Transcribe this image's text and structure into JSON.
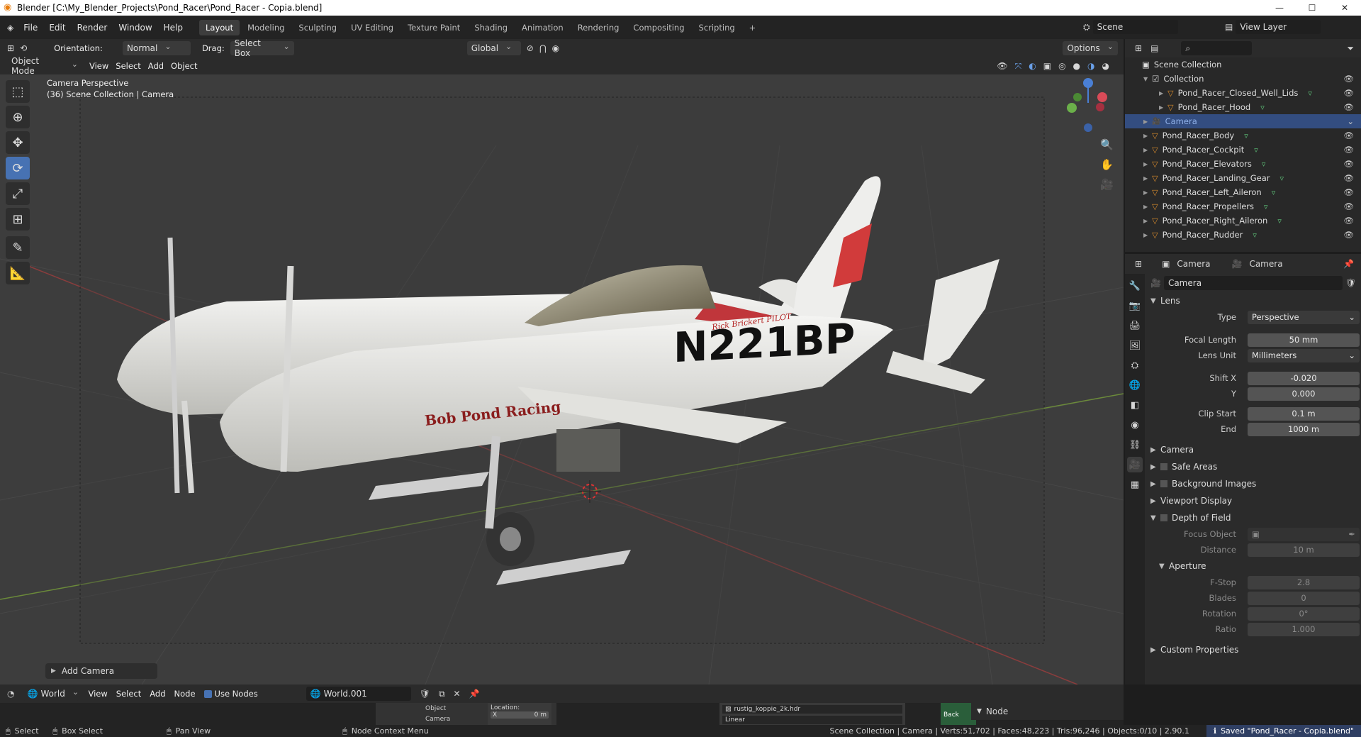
{
  "app": {
    "title": "Blender [C:\\My_Blender_Projects\\Pond_Racer\\Pond_Racer - Copia.blend]",
    "min": "—",
    "max": "☐",
    "close": "✕"
  },
  "menu": [
    "File",
    "Edit",
    "Render",
    "Window",
    "Help"
  ],
  "workspaces": [
    "Layout",
    "Modeling",
    "Sculpting",
    "UV Editing",
    "Texture Paint",
    "Shading",
    "Animation",
    "Rendering",
    "Compositing",
    "Scripting",
    "+"
  ],
  "active_workspace": "Layout",
  "scene": "Scene",
  "view_layer": "View Layer",
  "header": {
    "orientation_label": "Orientation:",
    "orientation": "Normal",
    "drag_label": "Drag:",
    "drag": "Select Box",
    "transform": "Global",
    "options": "Options"
  },
  "header2": {
    "mode": "Object Mode",
    "menus": [
      "View",
      "Select",
      "Add",
      "Object"
    ]
  },
  "viewport": {
    "line1": "Camera Perspective",
    "line2": "(36) Scene Collection | Camera",
    "operator_panel": "Add Camera",
    "registration": "N221BP",
    "livery": "Bob Pond Racing",
    "pilot": "Rick Brickert PILOT"
  },
  "outliner": {
    "root": "Scene Collection",
    "items": [
      {
        "name": "Collection",
        "level": 1
      },
      {
        "name": "Pond_Racer_Closed_Well_Lids",
        "level": 2
      },
      {
        "name": "Pond_Racer_Hood",
        "level": 2
      },
      {
        "name": "Camera",
        "level": 1,
        "selected": true
      },
      {
        "name": "Pond_Racer_Body",
        "level": 1
      },
      {
        "name": "Pond_Racer_Cockpit",
        "level": 1
      },
      {
        "name": "Pond_Racer_Elevators",
        "level": 1
      },
      {
        "name": "Pond_Racer_Landing_Gear",
        "level": 1
      },
      {
        "name": "Pond_Racer_Left_Aileron",
        "level": 1
      },
      {
        "name": "Pond_Racer_Propellers",
        "level": 1
      },
      {
        "name": "Pond_Racer_Right_Aileron",
        "level": 1
      },
      {
        "name": "Pond_Racer_Rudder",
        "level": 1
      }
    ]
  },
  "properties": {
    "breadcrumb_obj": "Camera",
    "breadcrumb_data": "Camera",
    "datablock": "Camera",
    "lens_title": "Lens",
    "type_label": "Type",
    "type": "Perspective",
    "focal_label": "Focal Length",
    "focal": "50 mm",
    "unit_label": "Lens Unit",
    "unit": "Millimeters",
    "shiftx_label": "Shift X",
    "shiftx": "-0.020",
    "shifty_label": "Y",
    "shifty": "0.000",
    "clipstart_label": "Clip Start",
    "clipstart": "0.1 m",
    "clipend_label": "End",
    "clipend": "1000 m",
    "panels": [
      "Camera",
      "Safe Areas",
      "Background Images",
      "Viewport Display",
      "Depth of Field"
    ],
    "focus_label": "Focus Object",
    "distance_label": "Distance",
    "distance": "10 m",
    "aperture_title": "Aperture",
    "fstop_label": "F-Stop",
    "fstop": "2.8",
    "blades_label": "Blades",
    "blades": "0",
    "rotation_label": "Rotation",
    "rotation": "0°",
    "ratio_label": "Ratio",
    "ratio": "1.000",
    "custom": "Custom Properties"
  },
  "shader": {
    "type": "World",
    "menus": [
      "View",
      "Select",
      "Add",
      "Node"
    ],
    "use_nodes": "Use Nodes",
    "world": "World.001",
    "node_label": "Node",
    "hdr": "rustig_koppie_2k.hdr",
    "interp": "Linear",
    "location": "Location:",
    "x": "X",
    "xval": "0 m",
    "obj": "Object",
    "cam": "Camera",
    "back": "Back"
  },
  "status": {
    "select": "Select",
    "box": "Box Select",
    "pan": "Pan View",
    "ctx": "Node Context Menu",
    "stats": "Scene Collection | Camera | Verts:51,702 | Faces:48,223 | Tris:96,246 | Objects:0/10 | 2.90.1",
    "saved": "Saved \"Pond_Racer - Copia.blend\""
  },
  "colors": {
    "accent": "#4772b3",
    "select": "#334d80",
    "orange": "#d88b2c",
    "vg": "#5fc47a"
  }
}
